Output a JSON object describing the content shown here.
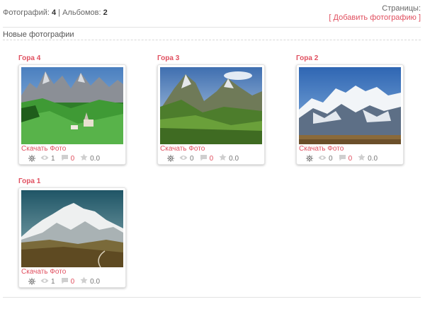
{
  "header": {
    "photos_label": "Фотографий:",
    "photos_count": "4",
    "separator": "|",
    "albums_label": "Альбомов:",
    "albums_count": "2",
    "pages_label": "Страницы:",
    "add_bracket_open": "[",
    "add_photo_label": "Добавить фотографию",
    "add_bracket_close": "]"
  },
  "section_title": "Новые фотографии",
  "photos": [
    {
      "title": "Гора 4",
      "download_label": "Скачать Фото",
      "views": "1",
      "comments": "0",
      "rating": "0.0"
    },
    {
      "title": "Гора 3",
      "download_label": "Скачать Фото",
      "views": "0",
      "comments": "0",
      "rating": "0.0"
    },
    {
      "title": "Гора 2",
      "download_label": "Скачать Фото",
      "views": "0",
      "comments": "0",
      "rating": "0.0"
    },
    {
      "title": "Гора 1",
      "download_label": "Скачать Фото",
      "views": "1",
      "comments": "0",
      "rating": "0.0"
    }
  ],
  "icons": {
    "settings": "gear-icon",
    "views": "eye-icon",
    "comments": "speech-bubble-icon",
    "rating": "star-icon"
  },
  "colors": {
    "accent": "#e04f5f",
    "text": "#555555"
  }
}
